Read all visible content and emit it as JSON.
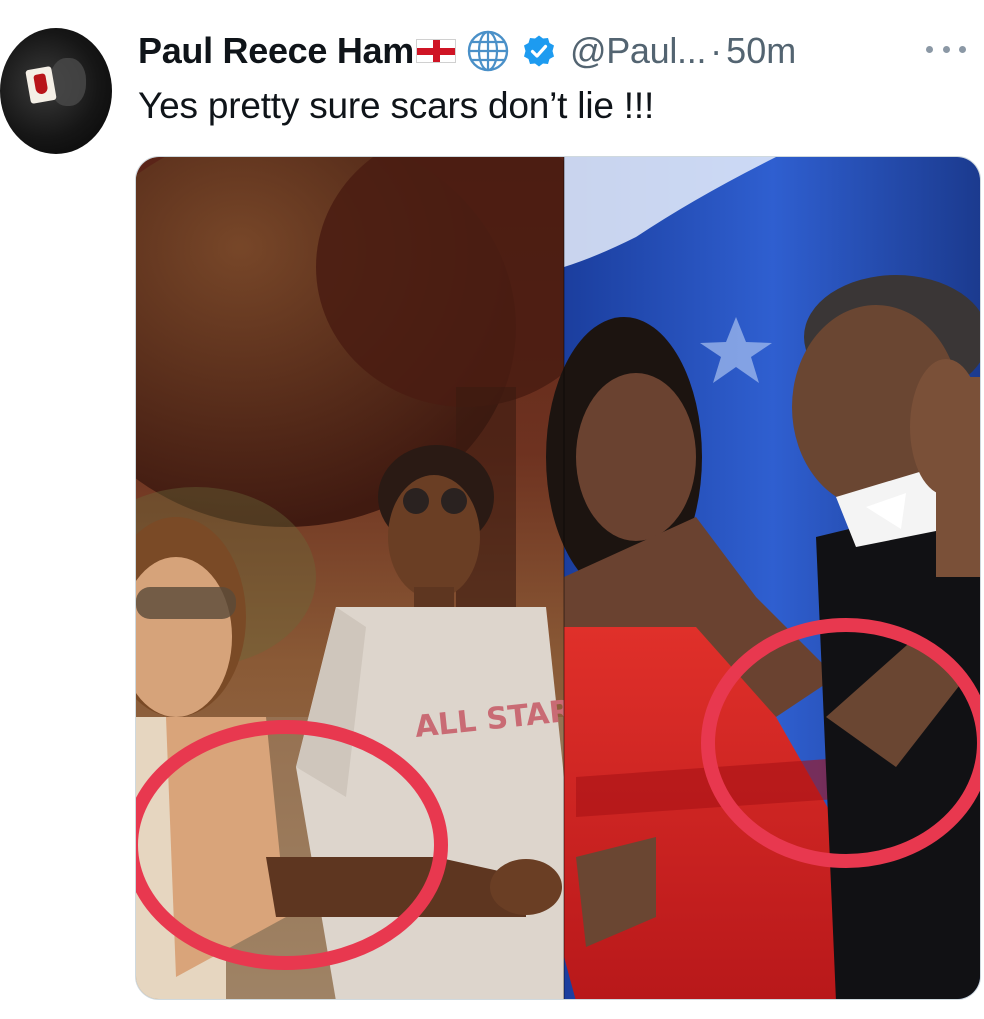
{
  "tweet": {
    "author_name": "Paul Reece Ham",
    "flag_icon": "england-flag-icon",
    "globe_icon": "globe-icon",
    "verified_icon": "verified-badge-icon",
    "handle": "@Paul...",
    "separator": "·",
    "timestamp": "50m",
    "more_icon": "more-options-icon",
    "text": "Yes pretty sure scars don’t lie !!!"
  },
  "media": {
    "image_text": "ALL STAR",
    "colors": {
      "circle_annotation": "#e8384f",
      "verified_blue": "#1d9bf0",
      "secondary_text": "#536471",
      "dress_red": "#d0201e",
      "stage_blue": "#2f5fd0"
    }
  }
}
